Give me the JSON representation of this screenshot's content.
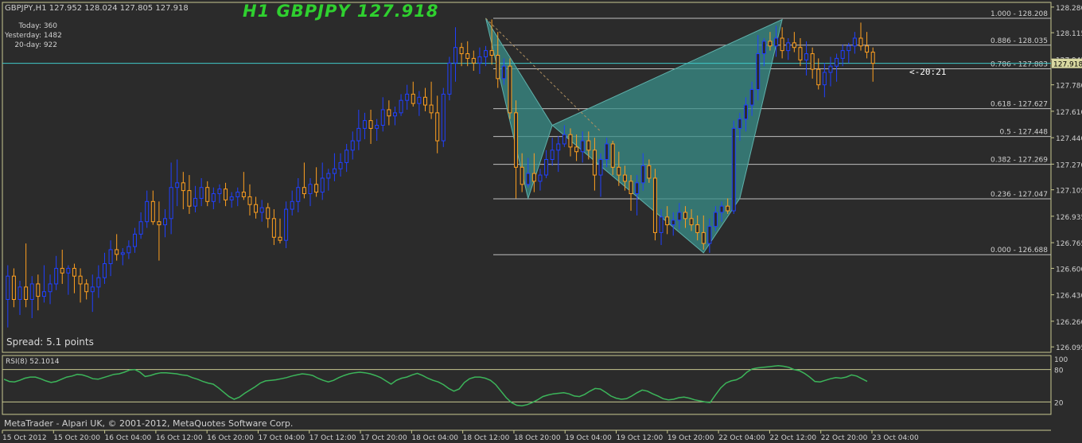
{
  "header": {
    "symbol_info": "GBPJPY,H1  127.952 128.024 127.805 127.918",
    "big_title": "H1 GBPJPY 127.918",
    "stats": [
      "Today: 360",
      "Yesterday: 1482",
      "20-day: 922"
    ]
  },
  "spread": "Spread: 5.1 points",
  "rsi_label": "RSI(8) 52.1014",
  "copyright": "MetaTrader - Alpari UK, © 2001-2012, MetaQuotes Software Corp.",
  "timer": "<-20:21",
  "colors": {
    "background": "#2b2b2b",
    "bull": "#2040ff",
    "bear": "#ffa020",
    "grid_frame": "#c8c890",
    "bid_line": "#40c8c8",
    "pattern_fill": "#3a8f8a",
    "rsi_line": "#3cb55a"
  },
  "chart_data": {
    "type": "candlestick",
    "symbol": "GBPJPY",
    "timeframe": "H1",
    "current_price": "127.918",
    "price_labels": [
      "128.280",
      "128.115",
      "127.945",
      "127.780",
      "127.610",
      "127.440",
      "127.270",
      "127.105",
      "126.935",
      "126.765",
      "126.600",
      "126.430",
      "126.260",
      "126.095"
    ],
    "price_range": [
      126.06,
      128.31
    ],
    "current_price_label": "127.918",
    "time_labels": [
      "15 Oct 2012",
      "15 Oct 20:00",
      "16 Oct 04:00",
      "16 Oct 12:00",
      "16 Oct 20:00",
      "17 Oct 04:00",
      "17 Oct 12:00",
      "17 Oct 20:00",
      "18 Oct 04:00",
      "18 Oct 12:00",
      "18 Oct 20:00",
      "19 Oct 04:00",
      "19 Oct 12:00",
      "19 Oct 20:00",
      "22 Oct 04:00",
      "22 Oct 12:00",
      "22 Oct 20:00",
      "23 Oct 04:00"
    ],
    "fibonacci": [
      {
        "label": "1.000 - 128.208",
        "price": 128.208
      },
      {
        "label": "0.886 - 128.035",
        "price": 128.035
      },
      {
        "label": "0.786 - 127.883",
        "price": 127.883
      },
      {
        "label": "0.618 - 127.627",
        "price": 127.627
      },
      {
        "label": "0.5 - 127.448",
        "price": 127.448
      },
      {
        "label": "0.382 - 127.269",
        "price": 127.269
      },
      {
        "label": "0.236 - 127.047",
        "price": 127.047
      },
      {
        "label": "0.000 - 126.688",
        "price": 126.688
      }
    ],
    "bid_line": 127.918,
    "rsi": {
      "period": 8,
      "value": 52.1014,
      "levels_labels": [
        "100",
        "80",
        "20"
      ],
      "levels": [
        100,
        80,
        20
      ],
      "values": [
        62,
        58,
        57,
        60,
        64,
        66,
        66,
        63,
        59,
        56,
        58,
        62,
        66,
        68,
        71,
        70,
        67,
        63,
        62,
        65,
        68,
        71,
        72,
        75,
        79,
        80,
        75,
        67,
        69,
        72,
        74,
        74,
        73,
        72,
        70,
        69,
        65,
        62,
        58,
        55,
        53,
        46,
        38,
        30,
        25,
        29,
        36,
        42,
        48,
        55,
        59,
        60,
        61,
        63,
        65,
        68,
        70,
        72,
        71,
        69,
        64,
        60,
        57,
        60,
        65,
        69,
        72,
        74,
        75,
        74,
        72,
        69,
        65,
        59,
        53,
        60,
        64,
        66,
        70,
        73,
        69,
        64,
        60,
        57,
        52,
        45,
        40,
        44,
        56,
        63,
        66,
        66,
        64,
        60,
        52,
        40,
        28,
        19,
        14,
        13,
        15,
        19,
        24,
        30,
        33,
        35,
        36,
        37,
        35,
        31,
        30,
        34,
        40,
        45,
        44,
        38,
        31,
        27,
        25,
        26,
        31,
        37,
        42,
        40,
        35,
        31,
        26,
        24,
        25,
        28,
        29,
        27,
        24,
        22,
        20,
        19,
        33,
        46,
        55,
        59,
        61,
        66,
        75,
        81,
        83,
        84,
        85,
        86,
        87,
        86,
        84,
        80,
        78,
        73,
        66,
        58,
        57,
        60,
        63,
        65,
        64,
        66,
        70,
        68,
        63,
        58
      ]
    },
    "candles": [
      [
        126.4,
        126.62,
        126.22,
        126.55
      ],
      [
        126.55,
        126.6,
        126.35,
        126.4
      ],
      [
        126.4,
        126.52,
        126.3,
        126.48
      ],
      [
        126.48,
        126.76,
        126.35,
        126.4
      ],
      [
        126.4,
        126.55,
        126.28,
        126.5
      ],
      [
        126.5,
        126.56,
        126.33,
        126.42
      ],
      [
        126.42,
        126.62,
        126.38,
        126.45
      ],
      [
        126.45,
        126.56,
        126.37,
        126.5
      ],
      [
        126.5,
        126.68,
        126.46,
        126.6
      ],
      [
        126.6,
        126.72,
        126.5,
        126.57
      ],
      [
        126.57,
        126.62,
        126.43,
        126.6
      ],
      [
        126.6,
        126.63,
        126.44,
        126.55
      ],
      [
        126.55,
        126.6,
        126.38,
        126.5
      ],
      [
        126.5,
        126.53,
        126.4,
        126.45
      ],
      [
        126.45,
        126.56,
        126.32,
        126.48
      ],
      [
        126.48,
        126.62,
        126.41,
        126.54
      ],
      [
        126.54,
        126.7,
        126.5,
        126.63
      ],
      [
        126.63,
        126.78,
        126.55,
        126.72
      ],
      [
        126.72,
        126.82,
        126.65,
        126.69
      ],
      [
        126.69,
        126.73,
        126.62,
        126.7
      ],
      [
        126.7,
        126.78,
        126.66,
        126.74
      ],
      [
        126.74,
        126.86,
        126.7,
        126.82
      ],
      [
        126.82,
        126.96,
        126.79,
        126.9
      ],
      [
        126.9,
        127.1,
        126.86,
        127.03
      ],
      [
        127.03,
        127.1,
        126.88,
        126.9
      ],
      [
        126.9,
        127.03,
        126.65,
        126.88
      ],
      [
        126.88,
        126.98,
        126.8,
        126.92
      ],
      [
        126.92,
        127.28,
        126.82,
        127.12
      ],
      [
        127.12,
        127.3,
        127.0,
        127.15
      ],
      [
        127.15,
        127.22,
        126.98,
        127.1
      ],
      [
        127.1,
        127.2,
        126.95,
        127.0
      ],
      [
        127.0,
        127.13,
        126.96,
        127.05
      ],
      [
        127.05,
        127.18,
        127.0,
        127.12
      ],
      [
        127.12,
        127.16,
        127.0,
        127.03
      ],
      [
        127.03,
        127.12,
        126.98,
        127.08
      ],
      [
        127.08,
        127.14,
        127.02,
        127.11
      ],
      [
        127.11,
        127.15,
        127.0,
        127.04
      ],
      [
        127.04,
        127.09,
        126.99,
        127.06
      ],
      [
        127.06,
        127.12,
        127.0,
        127.09
      ],
      [
        127.09,
        127.22,
        127.04,
        127.06
      ],
      [
        127.06,
        127.14,
        126.94,
        127.01
      ],
      [
        127.01,
        127.06,
        126.92,
        126.96
      ],
      [
        126.96,
        127.04,
        126.9,
        126.99
      ],
      [
        126.99,
        127.02,
        126.86,
        126.92
      ],
      [
        126.92,
        126.98,
        126.75,
        126.8
      ],
      [
        126.8,
        126.92,
        126.76,
        126.78
      ],
      [
        126.78,
        127.03,
        126.73,
        126.98
      ],
      [
        126.98,
        127.1,
        126.94,
        127.03
      ],
      [
        127.03,
        127.18,
        126.96,
        127.12
      ],
      [
        127.12,
        127.28,
        127.05,
        127.08
      ],
      [
        127.08,
        127.18,
        127.0,
        127.14
      ],
      [
        127.14,
        127.25,
        127.06,
        127.09
      ],
      [
        127.09,
        127.28,
        127.04,
        127.18
      ],
      [
        127.18,
        127.24,
        127.1,
        127.21
      ],
      [
        127.21,
        127.34,
        127.16,
        127.24
      ],
      [
        127.24,
        127.34,
        127.19,
        127.28
      ],
      [
        127.28,
        127.4,
        127.22,
        127.36
      ],
      [
        127.36,
        127.48,
        127.3,
        127.42
      ],
      [
        127.42,
        127.62,
        127.36,
        127.5
      ],
      [
        127.5,
        127.6,
        127.43,
        127.55
      ],
      [
        127.55,
        127.62,
        127.4,
        127.5
      ],
      [
        127.5,
        127.56,
        127.42,
        127.52
      ],
      [
        127.52,
        127.7,
        127.48,
        127.62
      ],
      [
        127.62,
        127.68,
        127.52,
        127.58
      ],
      [
        127.58,
        127.64,
        127.52,
        127.6
      ],
      [
        127.6,
        127.72,
        127.58,
        127.68
      ],
      [
        127.68,
        127.78,
        127.62,
        127.72
      ],
      [
        127.72,
        127.8,
        127.64,
        127.66
      ],
      [
        127.66,
        127.74,
        127.58,
        127.7
      ],
      [
        127.7,
        127.76,
        127.61,
        127.65
      ],
      [
        127.65,
        127.8,
        127.56,
        127.6
      ],
      [
        127.6,
        127.71,
        127.34,
        127.42
      ],
      [
        127.42,
        127.76,
        127.38,
        127.72
      ],
      [
        127.72,
        127.96,
        127.68,
        127.92
      ],
      [
        127.92,
        128.15,
        127.8,
        128.02
      ],
      [
        128.02,
        128.05,
        127.9,
        127.98
      ],
      [
        127.98,
        128.06,
        127.9,
        127.95
      ],
      [
        127.95,
        128.0,
        127.87,
        127.92
      ],
      [
        127.92,
        128.02,
        127.85,
        127.96
      ],
      [
        127.96,
        128.03,
        127.9,
        128.0
      ],
      [
        128.0,
        128.2,
        127.91,
        127.97
      ],
      [
        127.97,
        128.12,
        127.76,
        127.82
      ],
      [
        127.82,
        127.95,
        127.78,
        127.9
      ],
      [
        127.9,
        127.95,
        127.56,
        127.6
      ],
      [
        127.6,
        127.68,
        127.05,
        127.25
      ],
      [
        127.25,
        127.34,
        127.09,
        127.14
      ],
      [
        127.14,
        127.31,
        127.12,
        127.21
      ],
      [
        127.21,
        127.34,
        127.09,
        127.16
      ],
      [
        127.16,
        127.24,
        127.1,
        127.2
      ],
      [
        127.2,
        127.36,
        127.18,
        127.3
      ],
      [
        127.3,
        127.44,
        127.26,
        127.36
      ],
      [
        127.36,
        127.45,
        127.22,
        127.4
      ],
      [
        127.4,
        127.52,
        127.38,
        127.46
      ],
      [
        127.46,
        127.5,
        127.32,
        127.38
      ],
      [
        127.38,
        127.46,
        127.29,
        127.35
      ],
      [
        127.35,
        127.48,
        127.28,
        127.42
      ],
      [
        127.42,
        127.48,
        127.3,
        127.36
      ],
      [
        127.36,
        127.44,
        127.1,
        127.2
      ],
      [
        127.2,
        127.34,
        127.06,
        127.3
      ],
      [
        127.3,
        127.44,
        127.25,
        127.4
      ],
      [
        127.4,
        127.42,
        127.2,
        127.25
      ],
      [
        127.25,
        127.35,
        127.13,
        127.2
      ],
      [
        127.2,
        127.26,
        127.1,
        127.16
      ],
      [
        127.16,
        127.2,
        126.97,
        127.08
      ],
      [
        127.08,
        127.2,
        126.94,
        127.15
      ],
      [
        127.15,
        127.34,
        127.1,
        127.26
      ],
      [
        127.26,
        127.3,
        127.15,
        127.18
      ],
      [
        127.18,
        127.24,
        126.78,
        126.83
      ],
      [
        126.83,
        126.98,
        126.75,
        126.93
      ],
      [
        126.93,
        127.0,
        126.82,
        126.88
      ],
      [
        126.88,
        126.96,
        126.81,
        126.91
      ],
      [
        126.91,
        127.02,
        126.85,
        126.96
      ],
      [
        126.96,
        127.0,
        126.86,
        126.92
      ],
      [
        126.92,
        126.98,
        126.84,
        126.88
      ],
      [
        126.88,
        126.94,
        126.78,
        126.83
      ],
      [
        126.83,
        126.94,
        126.72,
        126.76
      ],
      [
        126.76,
        126.92,
        126.7,
        126.87
      ],
      [
        126.87,
        127.0,
        126.84,
        126.96
      ],
      [
        126.96,
        127.03,
        126.9,
        127.0
      ],
      [
        127.0,
        127.05,
        126.95,
        126.97
      ],
      [
        126.97,
        127.55,
        126.95,
        127.5
      ],
      [
        127.5,
        127.6,
        127.42,
        127.56
      ],
      [
        127.56,
        127.7,
        127.48,
        127.65
      ],
      [
        127.65,
        127.8,
        127.58,
        127.75
      ],
      [
        127.75,
        128.1,
        127.68,
        127.98
      ],
      [
        127.98,
        128.08,
        127.9,
        128.06
      ],
      [
        128.06,
        128.12,
        128.0,
        128.03
      ],
      [
        128.03,
        128.16,
        127.96,
        128.08
      ],
      [
        128.08,
        128.15,
        127.95,
        128.0
      ],
      [
        128.0,
        128.08,
        127.94,
        128.05
      ],
      [
        128.05,
        128.12,
        127.99,
        128.02
      ],
      [
        128.02,
        128.08,
        127.9,
        127.94
      ],
      [
        127.94,
        128.06,
        127.84,
        127.98
      ],
      [
        127.98,
        128.02,
        127.82,
        127.88
      ],
      [
        127.88,
        127.95,
        127.75,
        127.78
      ],
      [
        127.78,
        127.92,
        127.7,
        127.86
      ],
      [
        127.86,
        127.96,
        127.77,
        127.9
      ],
      [
        127.9,
        127.98,
        127.8,
        127.95
      ],
      [
        127.95,
        128.04,
        127.9,
        128.0
      ],
      [
        128.0,
        128.05,
        127.92,
        128.03
      ],
      [
        128.03,
        128.12,
        127.98,
        128.08
      ],
      [
        128.08,
        128.18,
        128.0,
        128.03
      ],
      [
        128.03,
        128.12,
        127.95,
        127.99
      ],
      [
        127.99,
        128.02,
        127.8,
        127.918
      ]
    ]
  }
}
